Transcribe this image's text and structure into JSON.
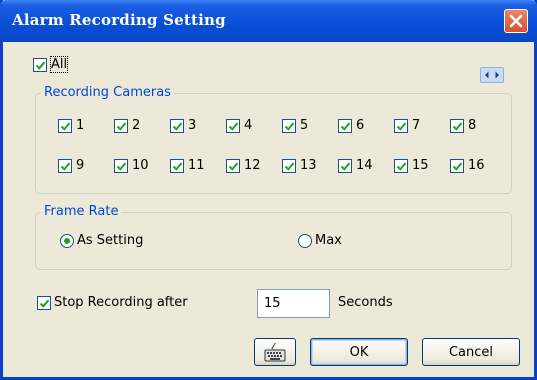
{
  "window": {
    "title": "Alarm Recording Setting"
  },
  "all_checkbox": {
    "label": "All",
    "checked": true
  },
  "recording_cameras": {
    "title": "Recording Cameras",
    "cameras": [
      {
        "label": "1",
        "checked": true
      },
      {
        "label": "2",
        "checked": true
      },
      {
        "label": "3",
        "checked": true
      },
      {
        "label": "4",
        "checked": true
      },
      {
        "label": "5",
        "checked": true
      },
      {
        "label": "6",
        "checked": true
      },
      {
        "label": "7",
        "checked": true
      },
      {
        "label": "8",
        "checked": true
      },
      {
        "label": "9",
        "checked": true
      },
      {
        "label": "10",
        "checked": true
      },
      {
        "label": "11",
        "checked": true
      },
      {
        "label": "12",
        "checked": true
      },
      {
        "label": "13",
        "checked": true
      },
      {
        "label": "14",
        "checked": true
      },
      {
        "label": "15",
        "checked": true
      },
      {
        "label": "16",
        "checked": true
      }
    ]
  },
  "frame_rate": {
    "title": "Frame Rate",
    "options": [
      {
        "label": "As Setting",
        "selected": true
      },
      {
        "label": "Max",
        "selected": false
      }
    ]
  },
  "stop_recording": {
    "label": "Stop Recording after",
    "checked": true,
    "value": "15",
    "unit": "Seconds"
  },
  "buttons": {
    "ok": "OK",
    "cancel": "Cancel"
  },
  "icons": {
    "close": "close-icon",
    "nav": "left-right-arrows-icon",
    "keyboard": "keyboard-icon",
    "check": "checkmark-icon"
  },
  "colors": {
    "titlebar": "#0a4fd8",
    "close_button": "#d5522d",
    "group_title": "#0046d5",
    "check": "#21a121",
    "dialog_bg": "#ece9d8"
  }
}
